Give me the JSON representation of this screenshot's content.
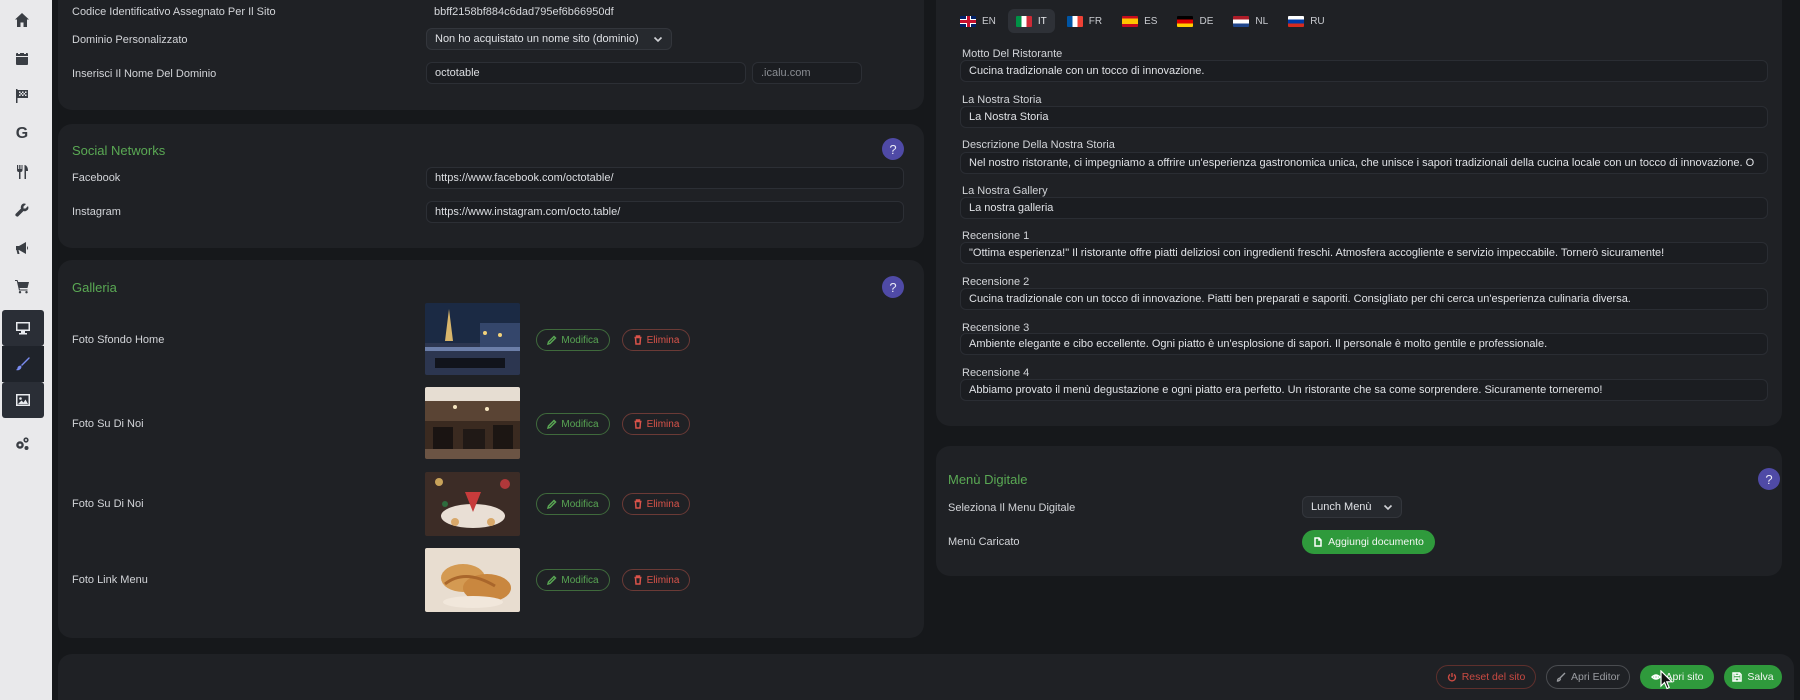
{
  "sidebar": {
    "icons": [
      "home-icon",
      "calendar-icon",
      "flag-icon",
      "google-icon",
      "cutlery-icon",
      "wrench-icon",
      "megaphone-icon",
      "cart-icon",
      "monitor-icon",
      "brush-icon",
      "image-icon",
      "gears-icon"
    ],
    "google_glyph": "G"
  },
  "site": {
    "id_label": "Codice Identificativo Assegnato Per Il Sito",
    "id_value": "bbff2158bf884c6dad795ef6b66950df",
    "domain_label": "Dominio Personalizzato",
    "domain_select": "Non ho acquistato un nome sito (dominio)",
    "domain_name_label": "Inserisci Il Nome Del Dominio",
    "domain_name_value": "octotable",
    "domain_suffix": ".icalu.com"
  },
  "social": {
    "title": "Social Networks",
    "help": "?",
    "facebook_label": "Facebook",
    "facebook_value": "https://www.facebook.com/octotable/",
    "instagram_label": "Instagram",
    "instagram_value": "https://www.instagram.com/octo.table/"
  },
  "gallery": {
    "title": "Galleria",
    "help": "?",
    "edit_label": "Modifica",
    "delete_label": "Elimina",
    "items": [
      {
        "label": "Foto Sfondo Home"
      },
      {
        "label": "Foto Su Di Noi"
      },
      {
        "label": "Foto Su Di Noi"
      },
      {
        "label": "Foto Link Menu"
      }
    ]
  },
  "languages": [
    {
      "code": "EN",
      "active": false
    },
    {
      "code": "IT",
      "active": true
    },
    {
      "code": "FR",
      "active": false
    },
    {
      "code": "ES",
      "active": false
    },
    {
      "code": "DE",
      "active": false
    },
    {
      "code": "NL",
      "active": false
    },
    {
      "code": "RU",
      "active": false
    }
  ],
  "texts": [
    {
      "label": "Motto Del Ristorante",
      "value": "Cucina tradizionale con un tocco di innovazione."
    },
    {
      "label": "La Nostra Storia",
      "value": "La Nostra Storia"
    },
    {
      "label": "Descrizione Della Nostra Storia",
      "value": "Nel nostro ristorante, ci impegniamo a offrire un'esperienza gastronomica unica, che unisce i sapori tradizionali della cucina locale con un tocco di innovazione. O"
    },
    {
      "label": "La Nostra Gallery",
      "value": "La nostra galleria"
    },
    {
      "label": "Recensione 1",
      "value": "\"Ottima esperienza!\" Il ristorante offre piatti deliziosi con ingredienti freschi. Atmosfera accogliente e servizio impeccabile. Tornerò sicuramente!"
    },
    {
      "label": "Recensione 2",
      "value": "Cucina tradizionale con un tocco di innovazione. Piatti ben preparati e saporiti. Consigliato per chi cerca un'esperienza culinaria diversa."
    },
    {
      "label": "Recensione 3",
      "value": "Ambiente elegante e cibo eccellente. Ogni piatto è un'esplosione di sapori. Il personale è molto gentile e professionale."
    },
    {
      "label": "Recensione 4",
      "value": "Abbiamo provato il menù degustazione e ogni piatto era perfetto. Un ristorante che sa come sorprendere. Sicuramente torneremo!"
    }
  ],
  "menu": {
    "title": "Menù Digitale",
    "help": "?",
    "select_label": "Seleziona Il Menu Digitale",
    "select_value": "Lunch Menù",
    "uploaded_label": "Menù Caricato",
    "add_doc": "Aggiungi documento"
  },
  "footer": {
    "reset": "Reset del sito",
    "open_editor": "Apri Editor",
    "open_site": "Apri sito",
    "save": "Salva"
  },
  "colors": {
    "accent_green": "#5aa954",
    "danger_red": "#d9534a",
    "help_purple": "#4f4aa6",
    "sidebar_bg": "#e9e9eb"
  }
}
